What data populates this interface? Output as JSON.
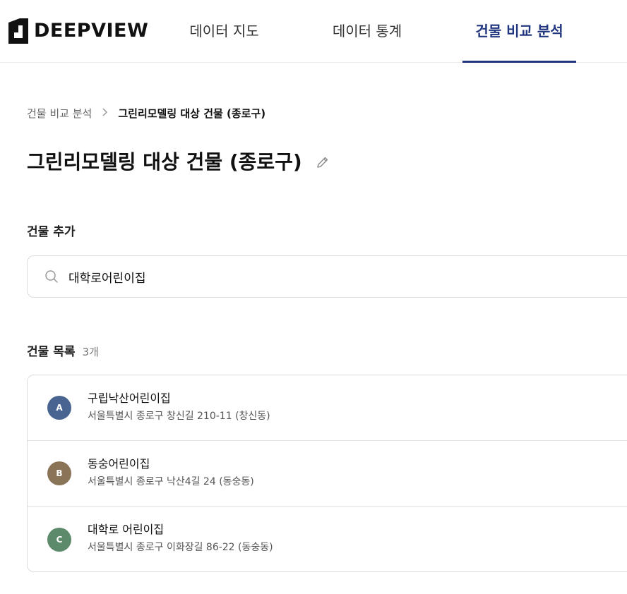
{
  "header": {
    "logo_text": "DEEPVIEW",
    "tabs": [
      {
        "label": "데이터 지도",
        "active": false
      },
      {
        "label": "데이터 통계",
        "active": false
      },
      {
        "label": "건물 비교 분석",
        "active": true
      }
    ]
  },
  "breadcrumb": {
    "parent": "건물 비교 분석",
    "current": "그린리모델링 대상 건물 (종로구)"
  },
  "page": {
    "title": "그린리모델링 대상 건물 (종로구)",
    "edit_icon": "pencil-icon"
  },
  "add_section": {
    "label": "건물 추가",
    "search_value": "대학로어린이집",
    "search_icon": "search-icon"
  },
  "list_section": {
    "label": "건물 목록",
    "count": "3개",
    "items": [
      {
        "badge": "A",
        "color": "#4a6491",
        "name": "구립낙산어린이집",
        "address": "서울특별시 종로구 창신길 210-11 (창신동)"
      },
      {
        "badge": "B",
        "color": "#8a7458",
        "name": "동숭어린이집",
        "address": "서울특별시 종로구 낙산4길 24 (동숭동)"
      },
      {
        "badge": "C",
        "color": "#5e8a6c",
        "name": "대학로 어린이집",
        "address": "서울특별시 종로구 이화장길 86-22 (동숭동)"
      }
    ]
  },
  "colors": {
    "accent": "#22367f",
    "border": "#dcdcdc"
  }
}
